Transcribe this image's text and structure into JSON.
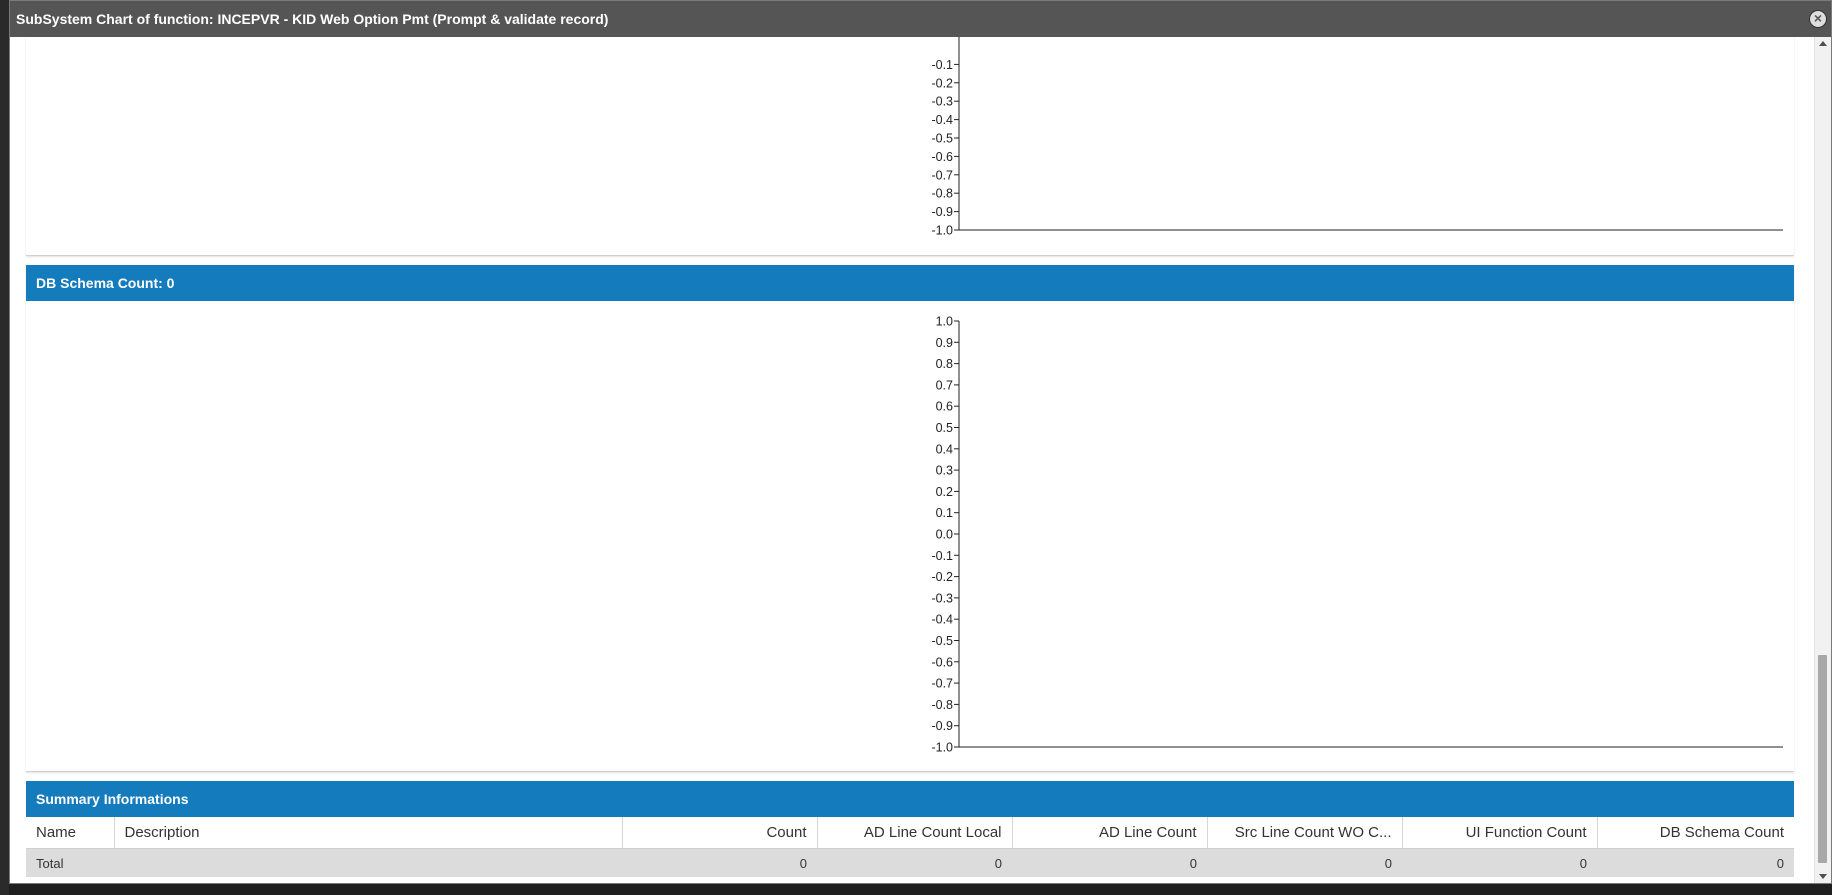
{
  "window": {
    "title": "SubSystem Chart of function: INCEPVR - KID Web Option Pmt (Prompt & validate record)",
    "close_icon": "close-icon"
  },
  "panels": {
    "db_schema": {
      "header": "DB Schema Count: 0"
    },
    "summary": {
      "header": "Summary Informations",
      "columns": [
        "Name",
        "Description",
        "Count",
        "AD Line Count Local",
        "AD Line Count",
        "Src Line Count WO C...",
        "UI Function Count",
        "DB Schema Count"
      ],
      "rows": [
        {
          "name": "Total",
          "description": "",
          "count": "0",
          "ad_line_count_local": "0",
          "ad_line_count": "0",
          "src_line_count_wo": "0",
          "ui_function_count": "0",
          "db_schema_count": "0"
        }
      ]
    }
  },
  "chart_data": [
    {
      "type": "bar",
      "title": "",
      "categories": [],
      "values": [],
      "ylim": [
        -1.0,
        1.0
      ],
      "visible_ticks": [
        "-0.1",
        "-0.2",
        "-0.3",
        "-0.4",
        "-0.5",
        "-0.6",
        "-0.7",
        "-0.8",
        "-0.9",
        "-1.0"
      ],
      "grid": false,
      "note_scrolled": "partially scrolled out of view"
    },
    {
      "type": "bar",
      "title": "",
      "categories": [],
      "values": [],
      "ylim": [
        -1.0,
        1.0
      ],
      "visible_ticks": [
        "1.0",
        "0.9",
        "0.8",
        "0.7",
        "0.6",
        "0.5",
        "0.4",
        "0.3",
        "0.2",
        "0.1",
        "0.0",
        "-0.1",
        "-0.2",
        "-0.3",
        "-0.4",
        "-0.5",
        "-0.6",
        "-0.7",
        "-0.8",
        "-0.9",
        "-1.0"
      ],
      "grid": false
    }
  ]
}
